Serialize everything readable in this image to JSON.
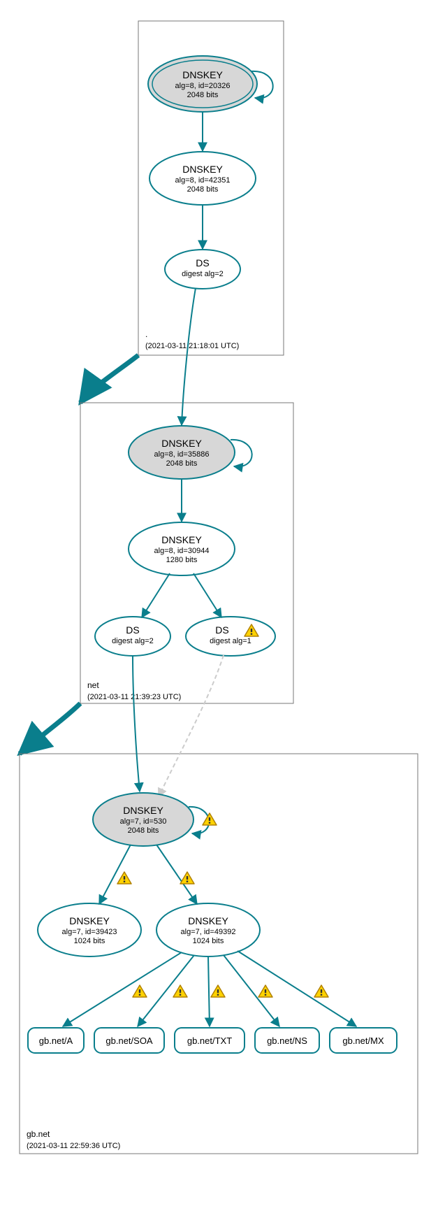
{
  "colors": {
    "teal": "#0a7e8c",
    "nodeGrey": "#d7d7d7",
    "warnFill": "#ffd200",
    "warnStroke": "#b08000"
  },
  "zones": {
    "root": {
      "label": ".",
      "timestamp": "(2021-03-11 21:18:01 UTC)"
    },
    "net": {
      "label": "net",
      "timestamp": "(2021-03-11 21:39:23 UTC)"
    },
    "gbnet": {
      "label": "gb.net",
      "timestamp": "(2021-03-11 22:59:36 UTC)"
    }
  },
  "nodes": {
    "root_ksk": {
      "title": "DNSKEY",
      "l2": "alg=8, id=20326",
      "l3": "2048 bits"
    },
    "root_zsk": {
      "title": "DNSKEY",
      "l2": "alg=8, id=42351",
      "l3": "2048 bits"
    },
    "root_ds": {
      "title": "DS",
      "l2": "digest alg=2"
    },
    "net_ksk": {
      "title": "DNSKEY",
      "l2": "alg=8, id=35886",
      "l3": "2048 bits"
    },
    "net_zsk": {
      "title": "DNSKEY",
      "l2": "alg=8, id=30944",
      "l3": "1280 bits"
    },
    "net_ds1": {
      "title": "DS",
      "l2": "digest alg=2"
    },
    "net_ds2": {
      "title": "DS",
      "l2": "digest alg=1"
    },
    "gb_ksk": {
      "title": "DNSKEY",
      "l2": "alg=7, id=530",
      "l3": "2048 bits"
    },
    "gb_zsk1": {
      "title": "DNSKEY",
      "l2": "alg=7, id=39423",
      "l3": "1024 bits"
    },
    "gb_zsk2": {
      "title": "DNSKEY",
      "l2": "alg=7, id=49392",
      "l3": "1024 bits"
    }
  },
  "rr": {
    "a": "gb.net/A",
    "soa": "gb.net/SOA",
    "txt": "gb.net/TXT",
    "ns": "gb.net/NS",
    "mx": "gb.net/MX"
  }
}
